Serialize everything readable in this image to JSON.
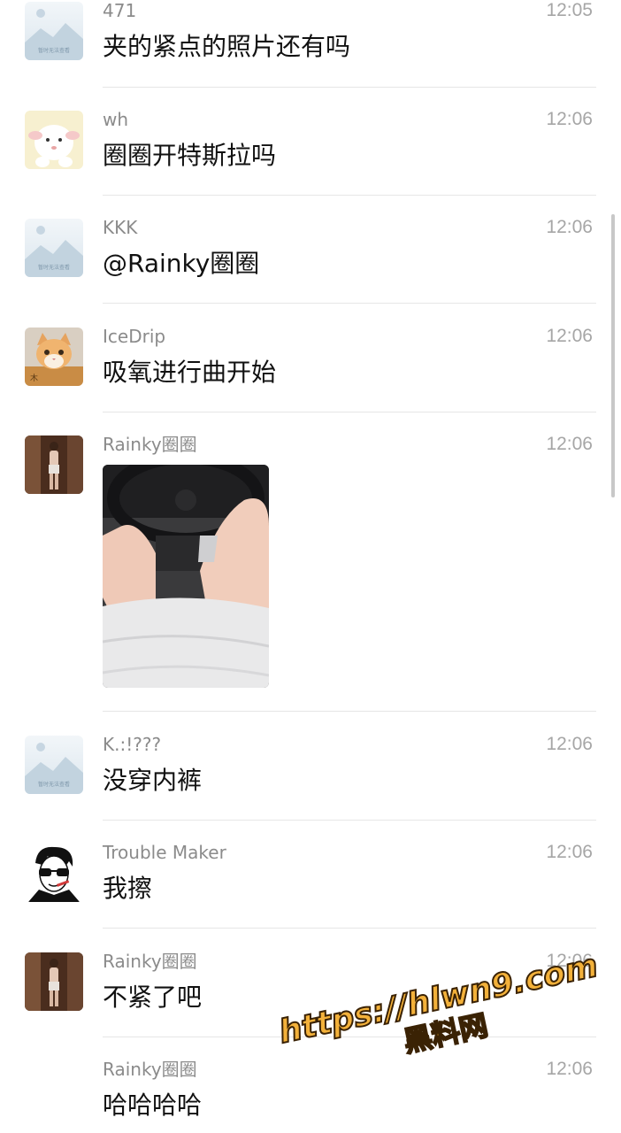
{
  "messages": [
    {
      "name": "471",
      "time": "12:05",
      "text": "夹的紧点的照片还有吗",
      "avatar": "placeholder-image-icon"
    },
    {
      "name": "wh",
      "time": "12:06",
      "text": "圈圈开特斯拉吗",
      "avatar": "cartoon-lamb-avatar"
    },
    {
      "name": "KKK",
      "time": "12:06",
      "text": "@Rainky圈圈",
      "avatar": "placeholder-image-icon"
    },
    {
      "name": "IceDrip",
      "time": "12:06",
      "text": "吸氧进行曲开始",
      "avatar": "cat-avatar"
    },
    {
      "name": "Rainky圈圈",
      "time": "12:06",
      "text": "",
      "avatar": "person-photo-avatar",
      "image": "car-interior-photo"
    },
    {
      "name": "K.:!???",
      "time": "12:06",
      "text": "没穿内裤",
      "avatar": "placeholder-image-icon"
    },
    {
      "name": "Trouble Maker",
      "time": "12:06",
      "text": "我擦",
      "avatar": "sunglasses-portrait-avatar"
    },
    {
      "name": "Rainky圈圈",
      "time": "12:06",
      "text": "不紧了吧",
      "avatar": "person-photo-avatar"
    },
    {
      "name": "Rainky圈圈",
      "time": "12:06",
      "text": "哈哈哈哈",
      "avatar": "none"
    }
  ],
  "placeholder_caption": "暂时无法查看",
  "watermark": {
    "url": "https://hlwn9.com",
    "label": "黑料网"
  },
  "colors": {
    "name": "#8b8b8b",
    "time": "#a6a6a6",
    "text": "#111111",
    "divider": "#e6e6e6",
    "watermark": "#f3b13a"
  }
}
